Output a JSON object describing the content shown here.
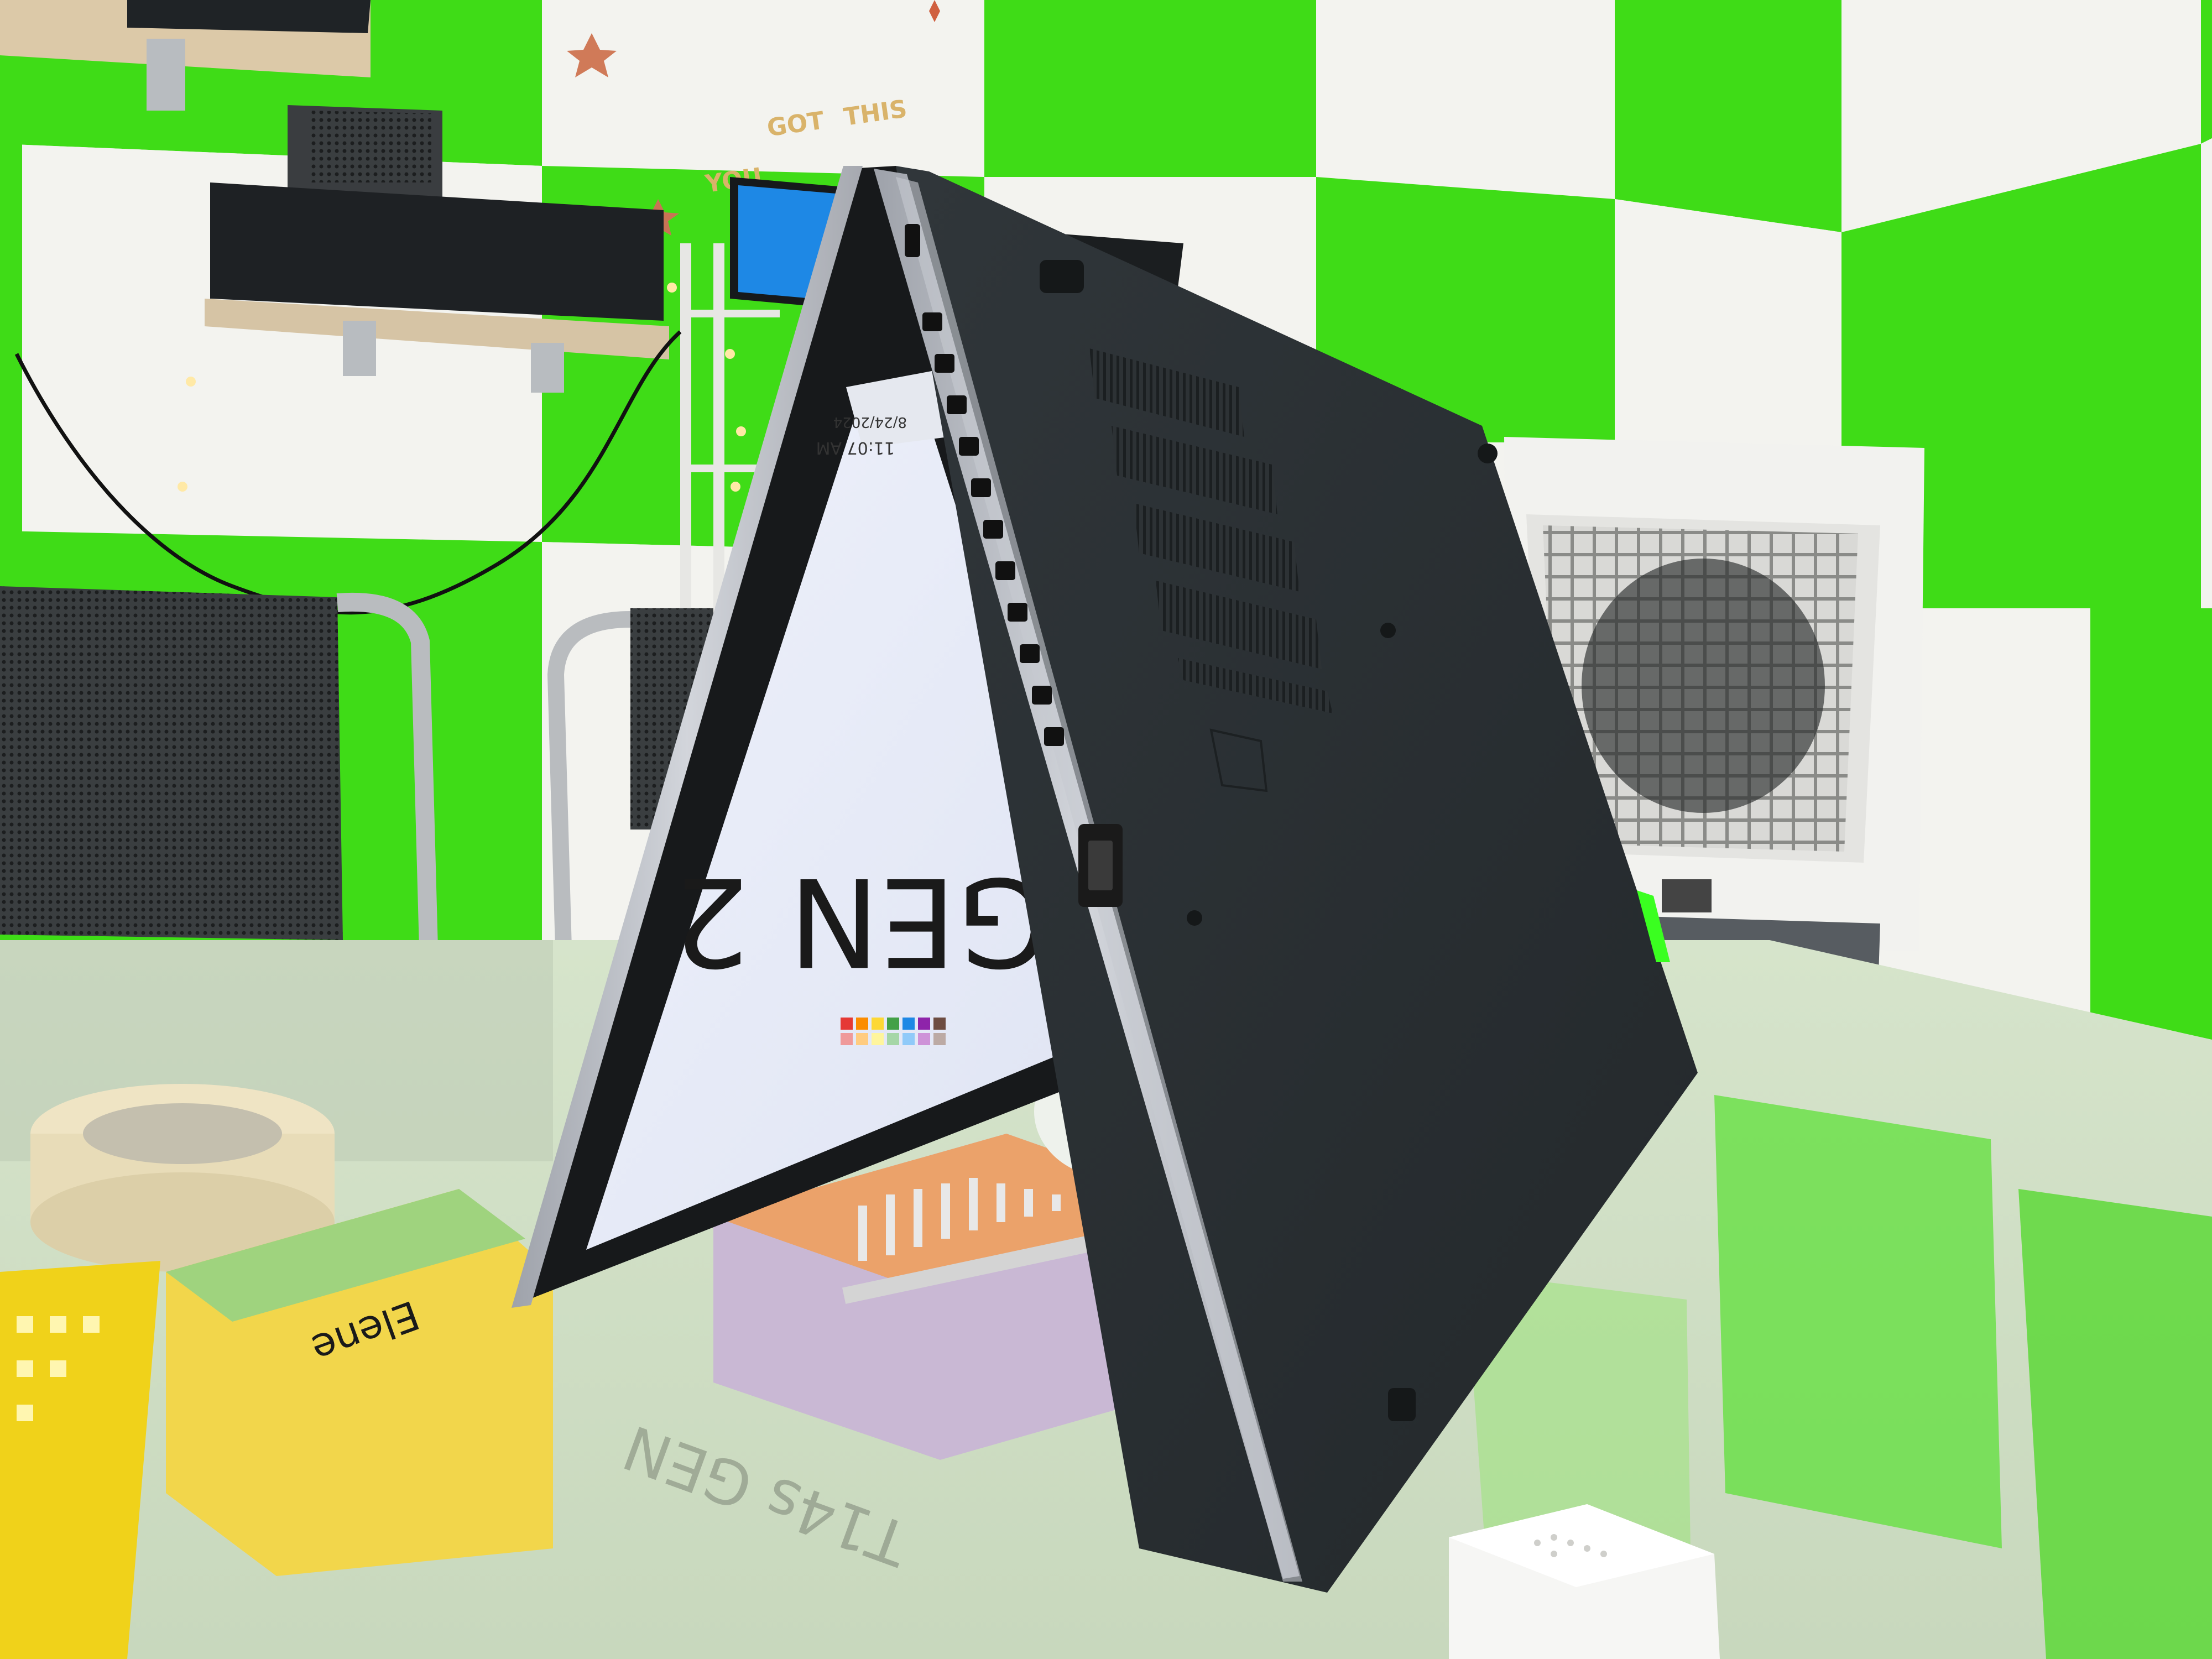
{
  "scene": {
    "wall_text": [
      "YOU",
      "GOT",
      "THIS"
    ],
    "screen_heading": "GEN 2",
    "taskbar_time": "11:07 AM",
    "taskbar_date": "8/24/2024",
    "reflection_text": "T14s GEN",
    "packaging_brand": "Elene"
  },
  "colors": {
    "wall_green": "#3fdc17",
    "wall_white": "#f3f3ef",
    "laptop_body": "#2b3032",
    "laptop_edge": "#b8bcc4",
    "screen_bg": "#f4f6fb",
    "table_glass": "#d8e6cf",
    "tape_beige": "#efe4c4",
    "basket_yellow": "#f0d21a",
    "cooler_white": "#f2f2ef"
  }
}
